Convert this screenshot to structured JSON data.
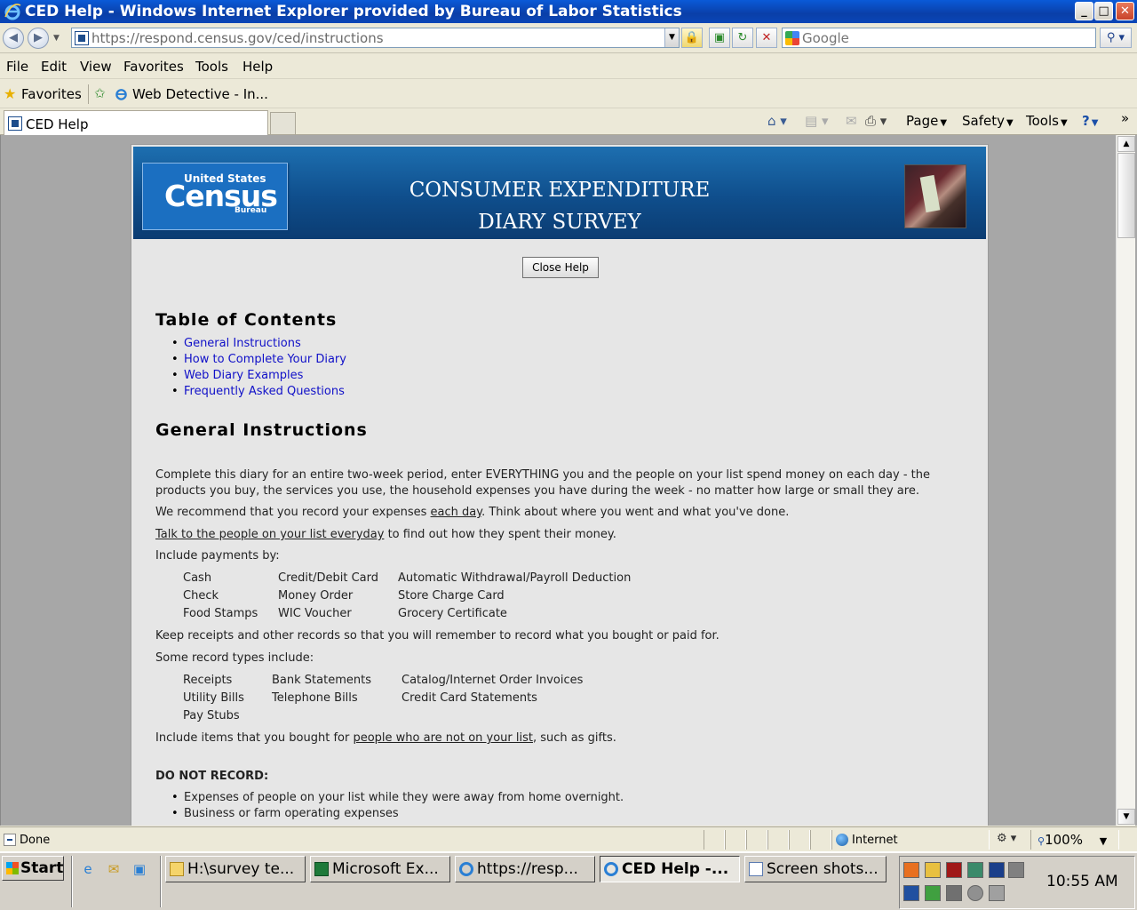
{
  "window": {
    "title": "CED Help - Windows Internet Explorer provided by Bureau of Labor Statistics",
    "min": "_",
    "max": "□",
    "close": "✕"
  },
  "address": {
    "url": "https://respond.census.gov/ced/instructions",
    "search_placeholder": "Google"
  },
  "menu": {
    "items": [
      "File",
      "Edit",
      "View",
      "Favorites",
      "Tools",
      "Help"
    ]
  },
  "favorites": {
    "label": "Favorites",
    "link": "Web Detective - In..."
  },
  "tab": {
    "label": "CED Help"
  },
  "commandbar": {
    "page": "Page",
    "safety": "Safety",
    "tools": "Tools",
    "help_icon": "?",
    "more": "»"
  },
  "banner": {
    "logo_top": "United States",
    "logo_main": "Census",
    "logo_bottom": "Bureau",
    "title_line1": "CONSUMER EXPENDITURE",
    "title_line2": "DIARY SURVEY"
  },
  "close_help": "Close Help",
  "toc": {
    "heading": "Table of Contents",
    "items": [
      "General Instructions",
      "How to Complete Your Diary",
      "Web Diary Examples",
      "Frequently Asked Questions"
    ]
  },
  "general": {
    "heading": "General Instructions",
    "para1_line1": "Complete this diary for an entire two-week period, enter EVERYTHING you and the people on your list spend money on each day - the",
    "para1_line2": "products you buy, the services you use, the household expenses you have during the week - no matter how large or small they are.",
    "para2_before": "We recommend that you record your expenses ",
    "para2_link": "each day",
    "para2_after": ". Think about where you went and what you've done.",
    "para3_link": "Talk to the people on your list everyday",
    "para3_after": " to find out how they spent their money.",
    "payments_intro": "Include payments by:",
    "payments": [
      [
        "Cash",
        "Credit/Debit Card",
        "Automatic Withdrawal/Payroll Deduction"
      ],
      [
        "Check",
        "Money Order",
        "Store Charge Card"
      ],
      [
        "Food Stamps",
        "WIC Voucher",
        "Grocery Certificate"
      ]
    ],
    "keep_receipts": "Keep receipts and other records so that you will remember to record what you bought or paid for.",
    "records_intro": "Some record types include:",
    "records": [
      [
        "Receipts",
        "Bank Statements",
        "Catalog/Internet Order Invoices"
      ],
      [
        "Utility Bills",
        "Telephone Bills",
        "Credit Card Statements"
      ],
      [
        "Pay Stubs",
        "",
        ""
      ]
    ],
    "items_before": "Include items that you bought for ",
    "items_link": "people who are not on your list",
    "items_after": ", such as gifts.",
    "do_not_record": "DO NOT RECORD:",
    "do_not_items": [
      "Expenses of people on your list while they were away from home overnight.",
      "Business or farm operating expenses"
    ]
  },
  "status": {
    "text": "Done",
    "zone": "Internet",
    "zoom": "100%"
  },
  "taskbar": {
    "start": "Start",
    "tasks": [
      "H:\\survey te...",
      "Microsoft Ex...",
      "https://resp...",
      "CED Help -...",
      "Screen shots..."
    ],
    "clock": "10:55 AM"
  }
}
